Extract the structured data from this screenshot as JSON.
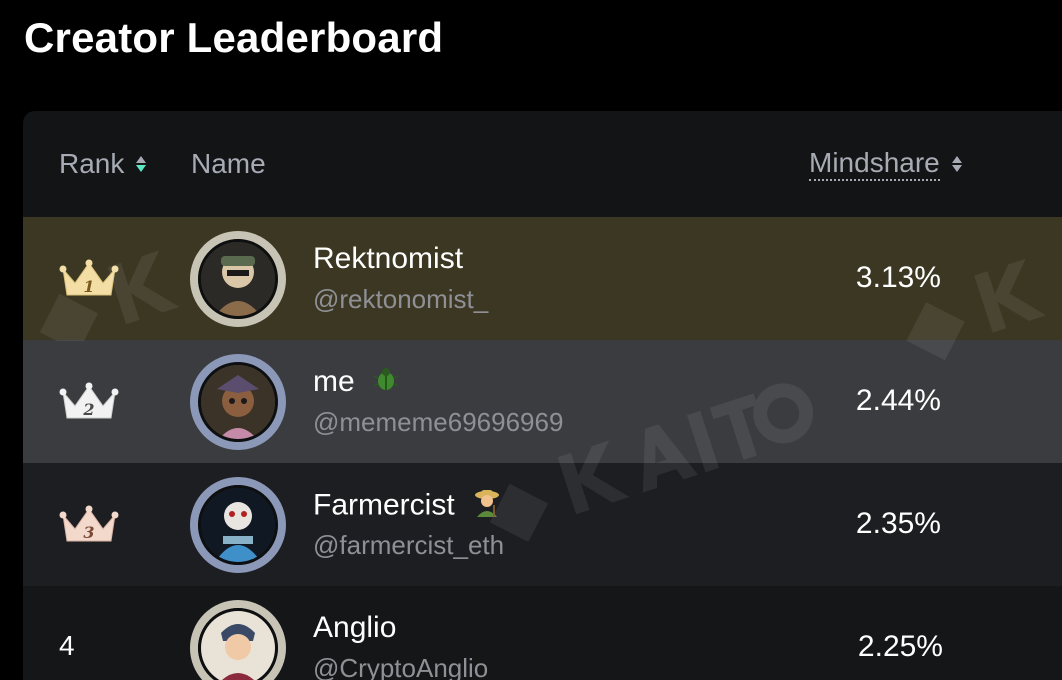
{
  "page": {
    "title": "Creator Leaderboard"
  },
  "table": {
    "columns": {
      "rank": "Rank",
      "name": "Name",
      "mindshare": "Mindshare"
    },
    "rows": [
      {
        "rank": "1",
        "rank_display": "crown-gold-icon",
        "name": "Rektnomist",
        "handle": "@rektonomist_",
        "mindshare": "3.13%"
      },
      {
        "rank": "2",
        "rank_display": "crown-silver-icon",
        "name": "me",
        "name_emoji": "beetle-emoji",
        "handle": "@mememe69696969",
        "mindshare": "2.44%"
      },
      {
        "rank": "3",
        "rank_display": "crown-bronze-icon",
        "name": "Farmercist",
        "name_emoji": "farmer-emoji",
        "handle": "@farmercist_eth",
        "mindshare": "2.35%"
      },
      {
        "rank": "4",
        "name": "Anglio",
        "handle": "@CryptoAnglio",
        "mindshare": "2.25%"
      }
    ]
  },
  "watermark": {
    "icon": "kaito-logo-icon"
  },
  "colors": {
    "row_gold": "#3b3722",
    "row_silver": "#3b3c3f",
    "row_bronze": "#1d1e21",
    "sort_active": "#5ee6c5"
  }
}
